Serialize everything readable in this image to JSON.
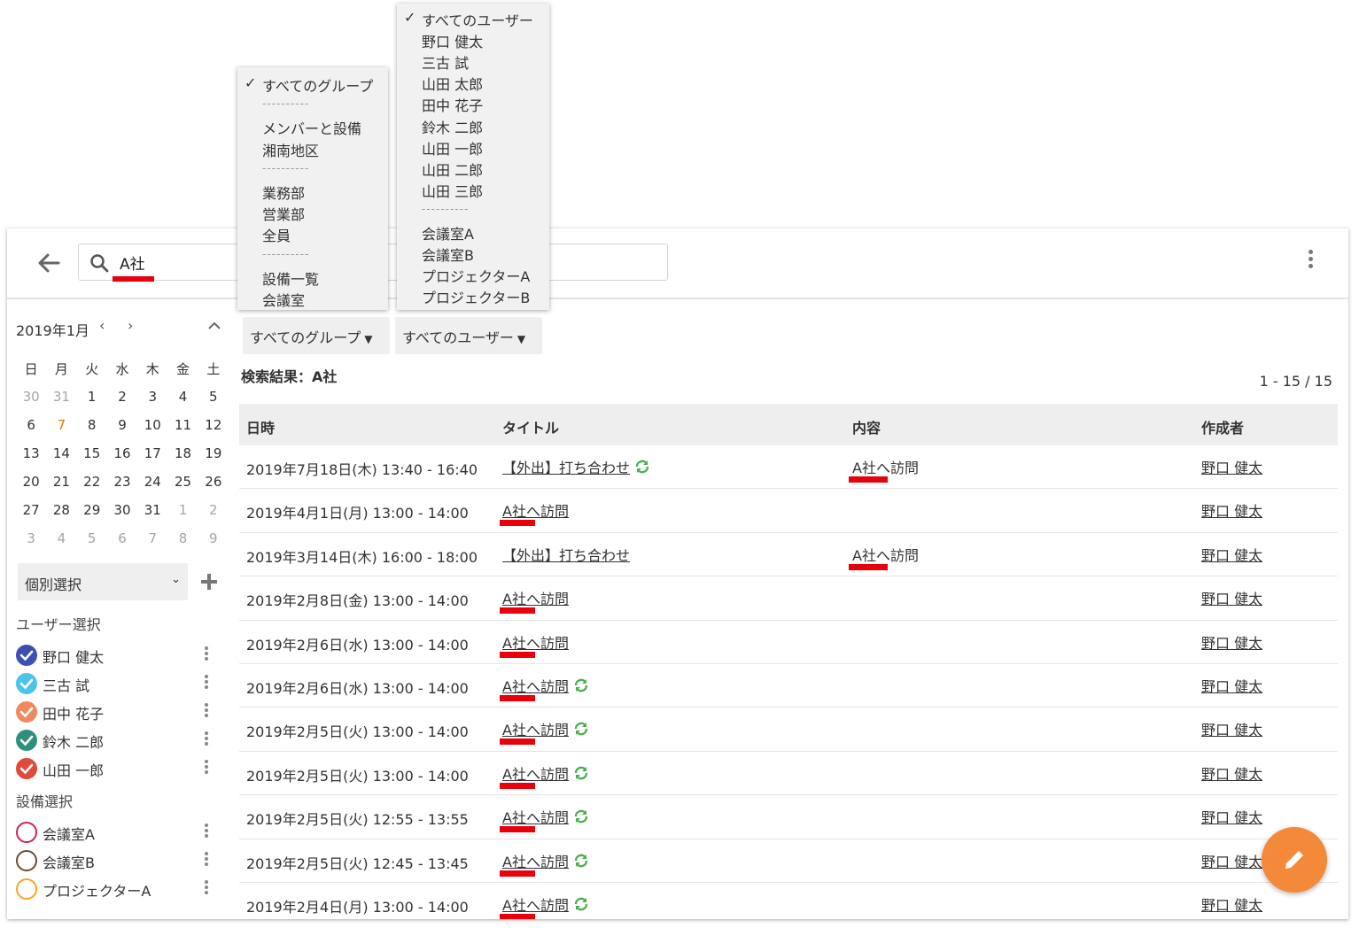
{
  "search": {
    "value": "A社"
  },
  "calendar": {
    "month_label": "2019年1月",
    "prev": "‹",
    "next": "›",
    "weekdays": [
      "日",
      "月",
      "火",
      "水",
      "木",
      "金",
      "土"
    ],
    "weeks": [
      [
        "30",
        "31",
        "1",
        "2",
        "3",
        "4",
        "5"
      ],
      [
        "6",
        "7",
        "8",
        "9",
        "10",
        "11",
        "12"
      ],
      [
        "13",
        "14",
        "15",
        "16",
        "17",
        "18",
        "19"
      ],
      [
        "20",
        "21",
        "22",
        "23",
        "24",
        "25",
        "26"
      ],
      [
        "27",
        "28",
        "29",
        "30",
        "31",
        "1",
        "2"
      ],
      [
        "3",
        "4",
        "5",
        "6",
        "7",
        "8",
        "9"
      ]
    ],
    "today": "7"
  },
  "sidebar": {
    "select_label": "個別選択",
    "user_section": "ユーザー選択",
    "users": [
      {
        "name": "野口 健太",
        "color": "#3d4fb3",
        "checked": true
      },
      {
        "name": "三古 試",
        "color": "#4cc3e8",
        "checked": true
      },
      {
        "name": "田中 花子",
        "color": "#f08a5d",
        "checked": true
      },
      {
        "name": "鈴木 二郎",
        "color": "#2f8f7d",
        "checked": true
      },
      {
        "name": "山田 一郎",
        "color": "#e04a3a",
        "checked": true
      }
    ],
    "equipment_section": "設備選択",
    "equipment": [
      {
        "name": "会議室A",
        "color": "#c8235a",
        "checked": false
      },
      {
        "name": "会議室B",
        "color": "#6b4a3a",
        "checked": false
      },
      {
        "name": "プロジェクターA",
        "color": "#f5a623",
        "checked": false
      }
    ]
  },
  "filters": {
    "group_label": "すべてのグループ",
    "user_label": "すべてのユーザー"
  },
  "results": {
    "title": "検索結果：A社",
    "count": "1 - 15 / 15",
    "headers": {
      "date": "日時",
      "title": "タイトル",
      "content": "内容",
      "author": "作成者"
    },
    "rows": [
      {
        "date": "2019年7月18日(木) 13:40 - 16:40",
        "title": "【外出】打ち合わせ",
        "repeat": true,
        "content": "A社へ訪問",
        "author": "野口 健太"
      },
      {
        "date": "2019年4月1日(月) 13:00 - 14:00",
        "title": "A社へ訪問",
        "repeat": false,
        "content": "",
        "author": "野口 健太"
      },
      {
        "date": "2019年3月14日(木) 16:00 - 18:00",
        "title": "【外出】打ち合わせ",
        "repeat": false,
        "content": "A社へ訪問",
        "author": "野口 健太"
      },
      {
        "date": "2019年2月8日(金) 13:00 - 14:00",
        "title": "A社へ訪問",
        "repeat": false,
        "content": "",
        "author": "野口 健太"
      },
      {
        "date": "2019年2月6日(水) 13:00 - 14:00",
        "title": "A社へ訪問",
        "repeat": false,
        "content": "",
        "author": "野口 健太"
      },
      {
        "date": "2019年2月6日(水) 13:00 - 14:00",
        "title": "A社へ訪問",
        "repeat": true,
        "content": "",
        "author": "野口 健太"
      },
      {
        "date": "2019年2月5日(火) 13:00 - 14:00",
        "title": "A社へ訪問",
        "repeat": true,
        "content": "",
        "author": "野口 健太"
      },
      {
        "date": "2019年2月5日(火) 13:00 - 14:00",
        "title": "A社へ訪問",
        "repeat": true,
        "content": "",
        "author": "野口 健太"
      },
      {
        "date": "2019年2月5日(火) 12:55 - 13:55",
        "title": "A社へ訪問",
        "repeat": true,
        "content": "",
        "author": "野口 健太"
      },
      {
        "date": "2019年2月5日(火) 12:45 - 13:45",
        "title": "A社へ訪問",
        "repeat": true,
        "content": "",
        "author": "野口 健太"
      },
      {
        "date": "2019年2月4日(月) 13:00 - 14:00",
        "title": "A社へ訪問",
        "repeat": true,
        "content": "",
        "author": "野口 健太"
      }
    ]
  },
  "group_menu": {
    "items": [
      "すべてのグループ",
      "----------",
      "メンバーと設備",
      "湘南地区",
      "----------",
      "業務部",
      "営業部",
      "全員",
      "----------",
      "設備一覧",
      "会議室"
    ],
    "selected": "すべてのグループ"
  },
  "user_menu": {
    "items": [
      "すべてのユーザー",
      "野口 健太",
      "三古 試",
      "山田 太郎",
      "田中 花子",
      "鈴木 二郎",
      "山田 一郎",
      "山田 二郎",
      "山田 三郎",
      "----------",
      "会議室A",
      "会議室B",
      "プロジェクターA",
      "プロジェクターB"
    ],
    "selected": "すべてのユーザー"
  },
  "colors": {
    "accent": "#f5893a",
    "highlight": "#e8000b",
    "repeat_icon": "#4caf50",
    "today_bg": "#fde7b3"
  }
}
